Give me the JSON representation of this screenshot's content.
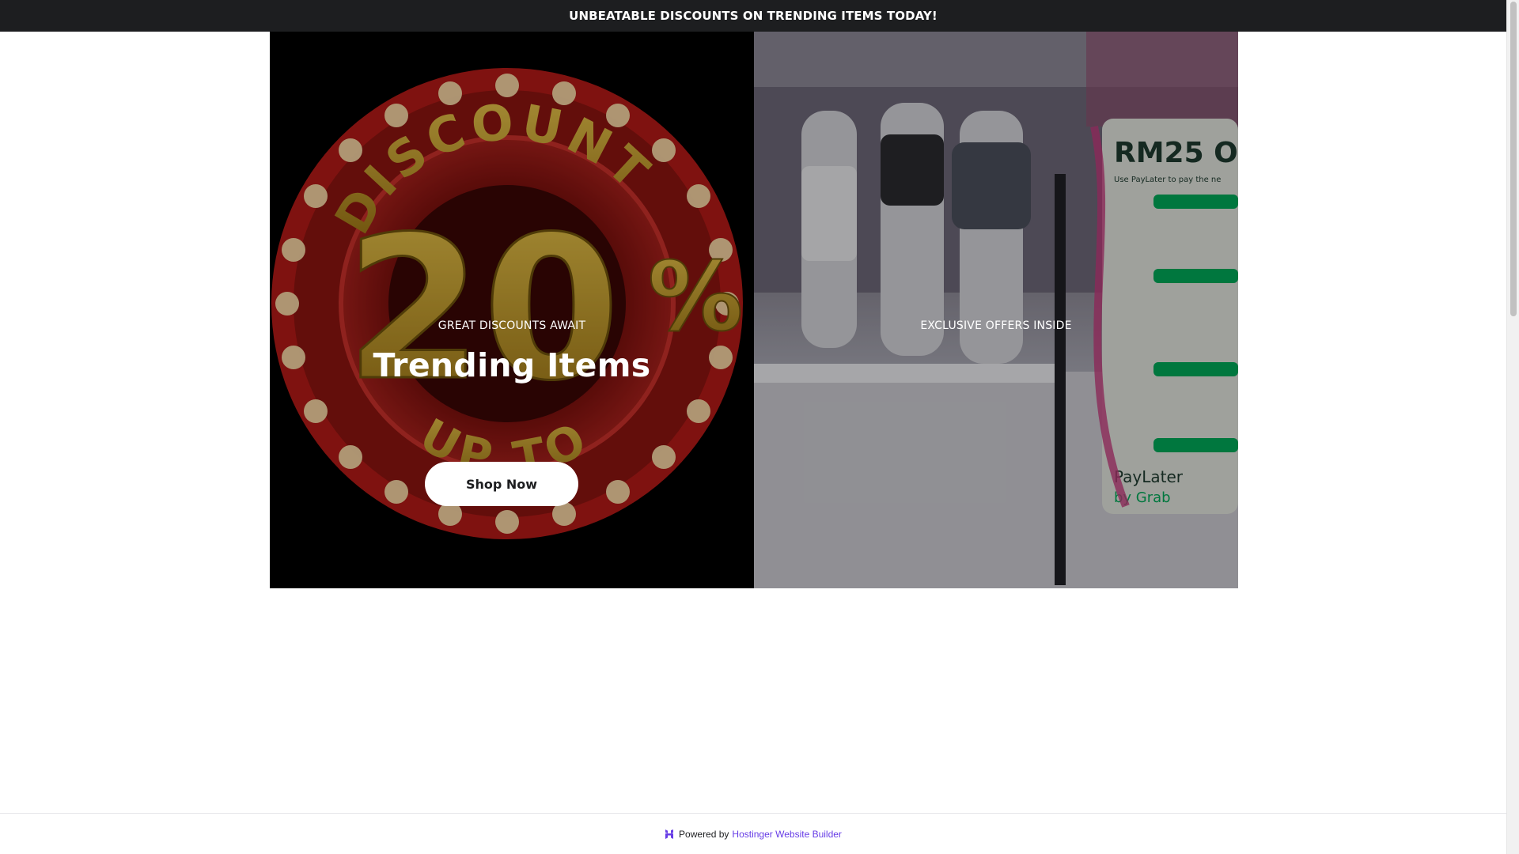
{
  "announcement": {
    "text": "UNBEATABLE DISCOUNTS ON TRENDING ITEMS TODAY!"
  },
  "hero": {
    "left": {
      "eyebrow": "GREAT DISCOUNTS AWAIT",
      "title": "Trending Items",
      "button_label": "Shop Now",
      "image_icon": "discount-20-percent-badge"
    },
    "right": {
      "eyebrow": "EXCLUSIVE OFFERS INSIDE",
      "image_icon": "store-mannequins-photo"
    }
  },
  "footer": {
    "powered_by": "Powered by",
    "link_text": "Hostinger Website Builder",
    "logo_icon": "hostinger-logo"
  },
  "colors": {
    "announcement_bg": "#1d1e20",
    "link": "#673de6",
    "badge_red": "#b01a17",
    "badge_gold": "#b8901f"
  }
}
